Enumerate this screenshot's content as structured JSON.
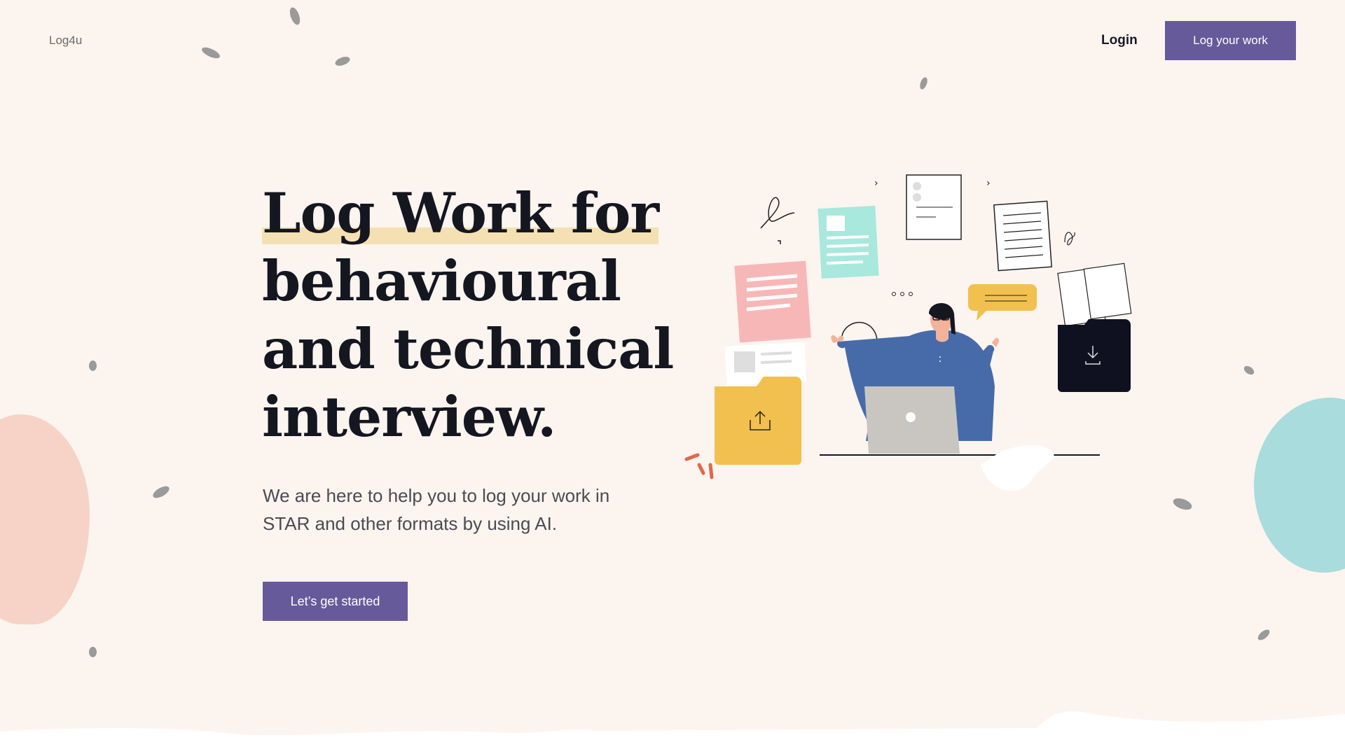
{
  "header": {
    "brand": "Log4u",
    "login_label": "Login",
    "cta_label": "Log your work"
  },
  "hero": {
    "headline_lines": [
      "Log Work for",
      "behavioural",
      "and technical",
      "interview."
    ],
    "subtitle": "We are here to help you to log your work in STAR and other formats by using AI.",
    "start_label": "Let’s get started"
  },
  "colors": {
    "background": "#fcf4ef",
    "accent": "#675a9a",
    "highlight": "#f4e0b2",
    "text_dark": "#141620"
  },
  "illustration": {
    "icons": [
      "upload-folder-icon",
      "download-folder-icon",
      "laptop-icon",
      "chat-bubble-icon",
      "document-icon"
    ]
  }
}
